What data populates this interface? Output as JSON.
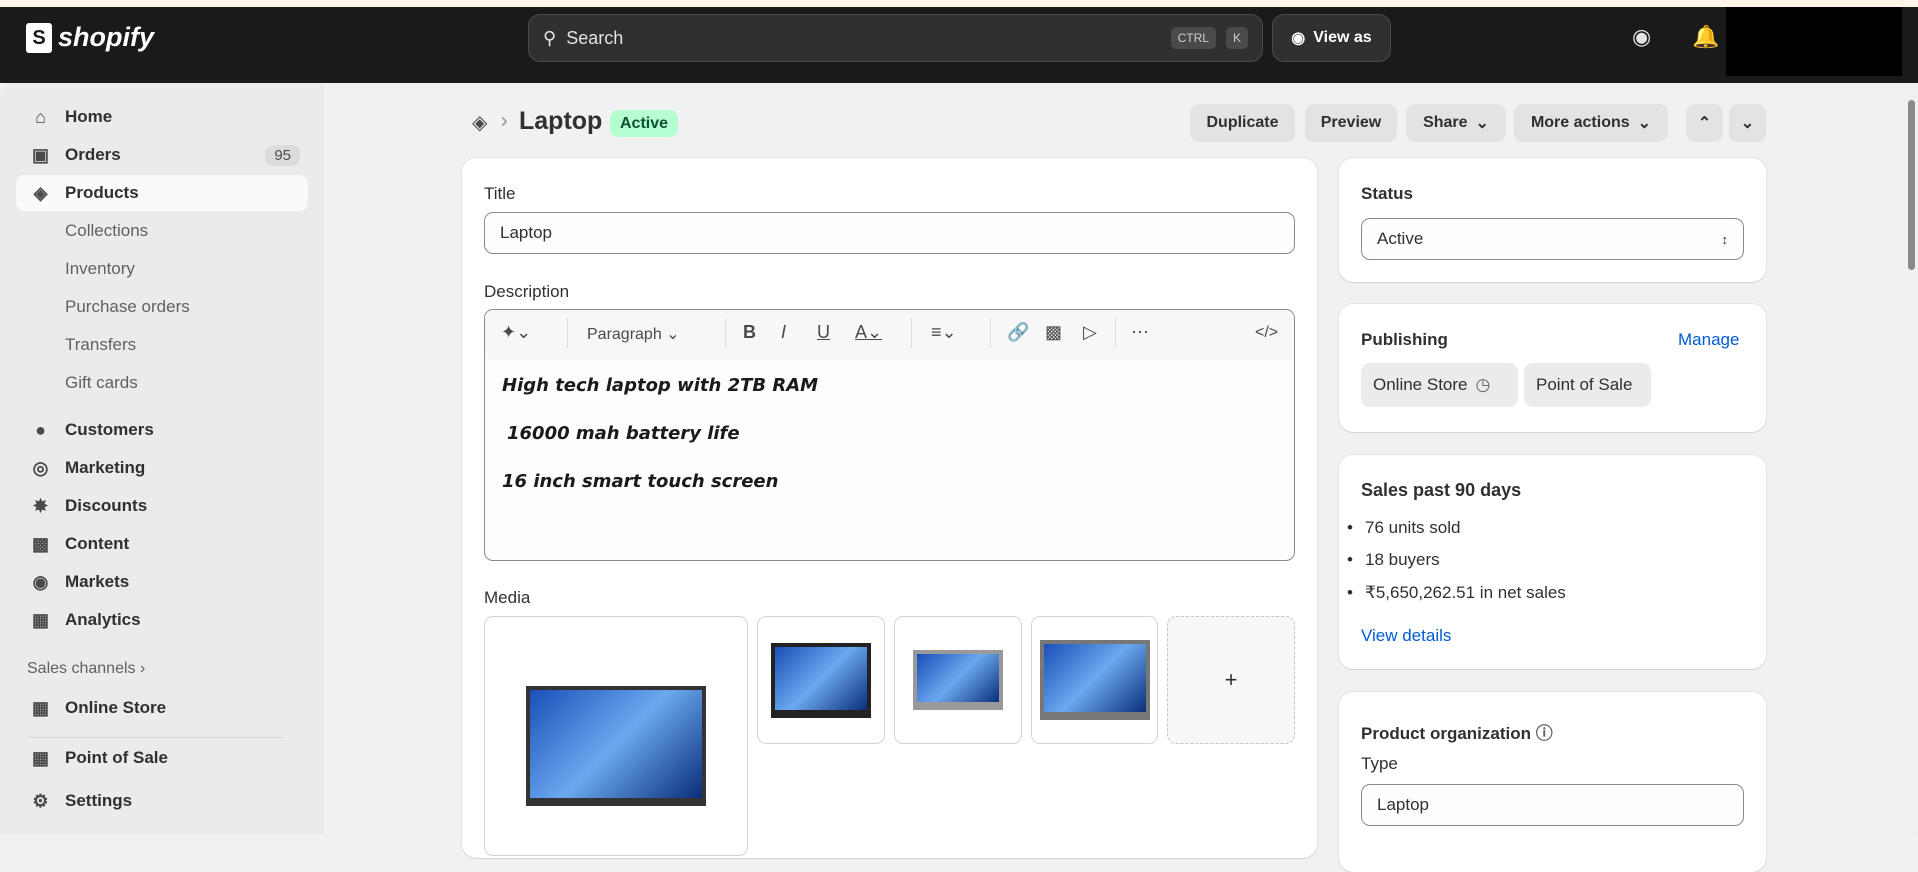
{
  "topbar": {
    "logo": "shopify",
    "search_placeholder": "Search",
    "kbd1": "CTRL",
    "kbd2": "K",
    "view_as": "View as"
  },
  "sidebar": {
    "items": [
      {
        "label": "Home",
        "icon": "home-icon"
      },
      {
        "label": "Orders",
        "badge": "95",
        "icon": "inbox-icon"
      },
      {
        "label": "Products",
        "icon": "tag-icon",
        "active": true
      },
      {
        "label": "Collections"
      },
      {
        "label": "Inventory"
      },
      {
        "label": "Purchase orders"
      },
      {
        "label": "Transfers"
      },
      {
        "label": "Gift cards"
      },
      {
        "label": "Customers",
        "icon": "person-icon"
      },
      {
        "label": "Marketing",
        "icon": "target-icon"
      },
      {
        "label": "Discounts",
        "icon": "discount-icon"
      },
      {
        "label": "Content",
        "icon": "image-icon"
      },
      {
        "label": "Markets",
        "icon": "globe-icon"
      },
      {
        "label": "Analytics",
        "icon": "chart-icon"
      }
    ],
    "sales_channels": "Sales channels",
    "online_store": "Online Store",
    "point_of_sale": "Point of Sale",
    "settings": "Settings"
  },
  "page": {
    "title": "Laptop",
    "status_badge": "Active",
    "actions": {
      "duplicate": "Duplicate",
      "preview": "Preview",
      "share": "Share",
      "more": "More actions"
    }
  },
  "main": {
    "title_label": "Title",
    "title_value": "Laptop",
    "description_label": "Description",
    "toolbar": {
      "paragraph": "Paragraph"
    },
    "description_lines": [
      "High tech laptop with 2TB RAM",
      "16000 mah battery life",
      "16 inch smart touch screen"
    ],
    "media_label": "Media",
    "add_media": "+"
  },
  "status": {
    "label": "Status",
    "value": "Active"
  },
  "publishing": {
    "label": "Publishing",
    "manage": "Manage",
    "channels": [
      "Online Store",
      "Point of Sale"
    ]
  },
  "sales": {
    "title": "Sales past 90 days",
    "items": [
      "76 units sold",
      "18 buyers",
      "₹5,650,262.51 in net sales"
    ],
    "link": "View details"
  },
  "organization": {
    "title": "Product organization",
    "type_label": "Type",
    "type_value": "Laptop"
  }
}
